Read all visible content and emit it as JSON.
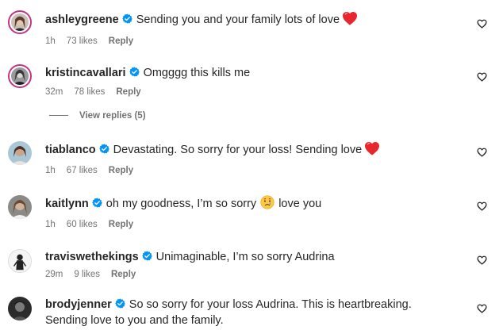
{
  "colors": {
    "text": "#262626",
    "meta": "#737373",
    "verified": "#0095f6",
    "heart_red": "#e8262d",
    "story_ring": "#c13584"
  },
  "comments": [
    {
      "username": "ashleygreene",
      "verified": true,
      "text": "Sending you and your family lots of love",
      "emoji": "red-heart",
      "time": "1h",
      "likes": "73 likes",
      "reply": "Reply",
      "avatar_ring": true
    },
    {
      "username": "kristincavallari",
      "verified": true,
      "text": "Omgggg this kills me",
      "emoji": "",
      "time": "32m",
      "likes": "78 likes",
      "reply": "Reply",
      "avatar_ring": true,
      "view_replies": "View replies (5)"
    },
    {
      "username": "tiablanco",
      "verified": true,
      "text": "Devastating. So sorry for your loss! Sending love",
      "emoji": "red-heart",
      "time": "1h",
      "likes": "67 likes",
      "reply": "Reply",
      "avatar_ring": false
    },
    {
      "username": "kaitlynn",
      "verified": true,
      "text": "oh my goodness, I’m so sorry",
      "text_after": "love you",
      "emoji": "crying-face",
      "time": "1h",
      "likes": "60 likes",
      "reply": "Reply",
      "avatar_ring": false
    },
    {
      "username": "traviswethekings",
      "verified": true,
      "text": "Unimaginable, I’m so sorry Audrina",
      "emoji": "",
      "time": "29m",
      "likes": "9 likes",
      "reply": "Reply",
      "avatar_ring": false
    },
    {
      "username": "brodyjenner",
      "verified": true,
      "text": "So so sorry for your loss Audrina. This is heartbreaking. Sending love to you and the family.",
      "emoji": "",
      "time": "",
      "likes": "",
      "reply": "",
      "avatar_ring": false
    }
  ],
  "icons": {
    "verified": "verified-badge-icon",
    "like": "heart-outline-icon"
  }
}
